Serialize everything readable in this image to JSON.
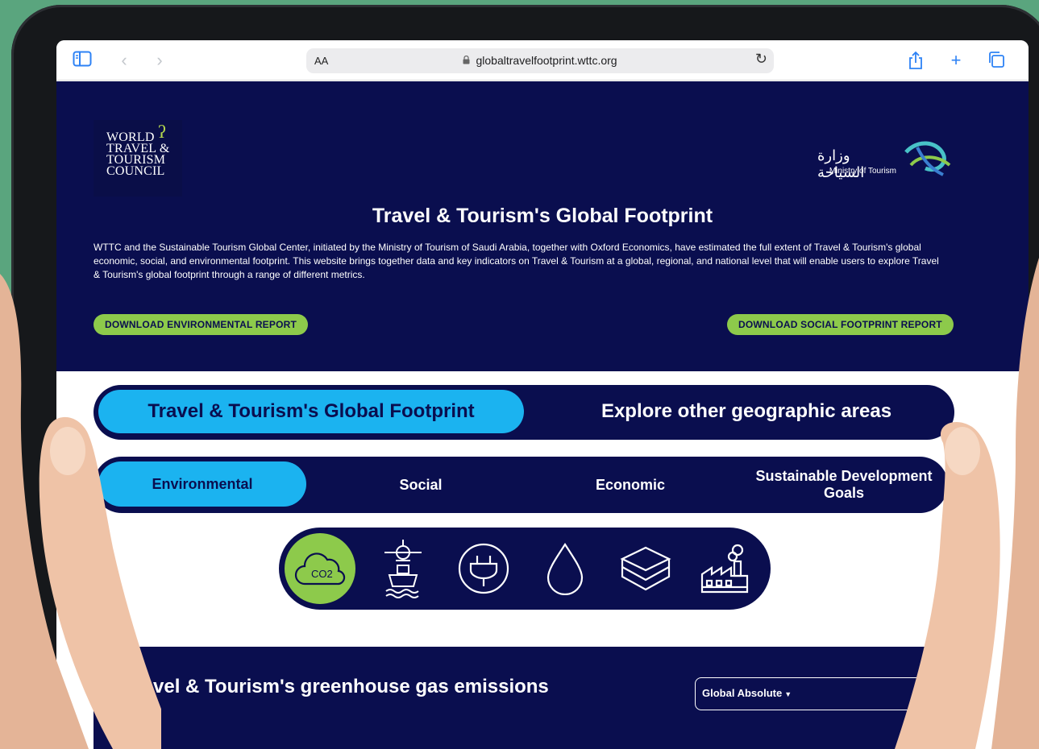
{
  "browser": {
    "aa_label": "AA",
    "url": "globaltravelfootprint.wttc.org"
  },
  "hero": {
    "logo_lines": [
      "WORLD",
      "TRAVEL &",
      "TOURISM",
      "COUNCIL"
    ],
    "ministry_ar": "وزارة السياحة",
    "ministry_en": "Ministry of Tourism",
    "title": "Travel & Tourism's Global Footprint",
    "description": "WTTC and the Sustainable Tourism Global Center, initiated by the Ministry of Tourism of Saudi Arabia, together with Oxford Economics, have estimated the full extent of Travel & Tourism's global economic, social, and environmental footprint. This website brings together data and key indicators on Travel & Tourism at a global, regional, and national level that will enable users to explore Travel & Tourism's global footprint through a range of different metrics.",
    "btn_env": "DOWNLOAD ENVIRONMENTAL REPORT",
    "btn_social": "DOWNLOAD SOCIAL FOOTPRINT REPORT"
  },
  "main_tabs": {
    "active": "Travel & Tourism's Global Footprint",
    "other": "Explore other geographic areas"
  },
  "sub_tabs": [
    "Environmental",
    "Social",
    "Economic",
    "Sustainable Development Goals"
  ],
  "metrics": [
    {
      "icon": "co2-cloud-icon",
      "active": true,
      "label": "CO2"
    },
    {
      "icon": "transport-icon",
      "active": false
    },
    {
      "icon": "plug-icon",
      "active": false
    },
    {
      "icon": "water-drop-icon",
      "active": false
    },
    {
      "icon": "box-icon",
      "active": false
    },
    {
      "icon": "factory-icon",
      "active": false
    }
  ],
  "emissions": {
    "title": "Travel & Tourism's greenhouse gas emissions",
    "select_value": "Global Absolute"
  },
  "colors": {
    "navy": "#0a0e4f",
    "cyan": "#1bb3f0",
    "green": "#8dca4b",
    "background": "#5aa57e"
  }
}
